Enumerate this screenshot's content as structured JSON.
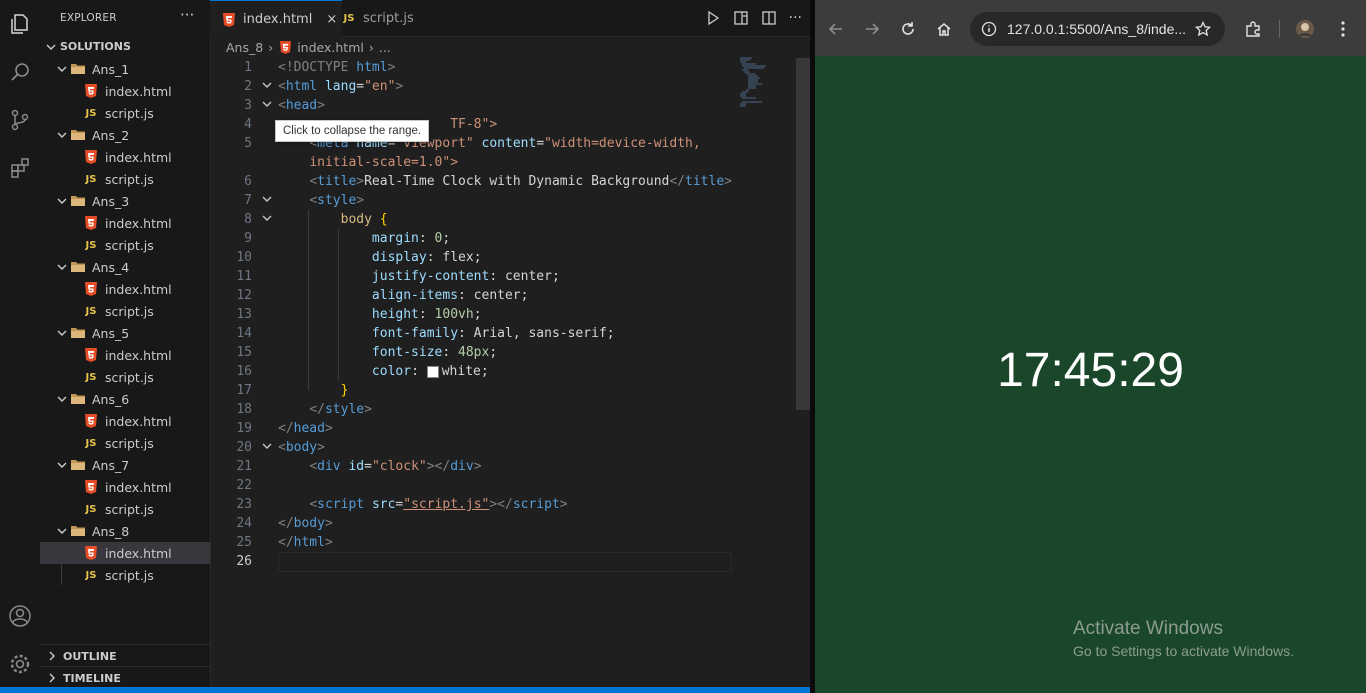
{
  "explorer": {
    "title": "EXPLORER",
    "more": "···",
    "root": "SOLUTIONS",
    "folders": [
      {
        "name": "Ans_1",
        "files": [
          "index.html",
          "script.js"
        ]
      },
      {
        "name": "Ans_2",
        "files": [
          "index.html",
          "script.js"
        ]
      },
      {
        "name": "Ans_3",
        "files": [
          "index.html",
          "script.js"
        ]
      },
      {
        "name": "Ans_4",
        "files": [
          "index.html",
          "script.js"
        ]
      },
      {
        "name": "Ans_5",
        "files": [
          "index.html",
          "script.js"
        ]
      },
      {
        "name": "Ans_6",
        "files": [
          "index.html",
          "script.js"
        ]
      },
      {
        "name": "Ans_7",
        "files": [
          "index.html",
          "script.js"
        ]
      },
      {
        "name": "Ans_8",
        "files": [
          "index.html",
          "script.js"
        ]
      }
    ],
    "selected": "Ans_8/index.html",
    "outline": "OUTLINE",
    "timeline": "TIMELINE"
  },
  "tabs": [
    {
      "label": "index.html",
      "icon": "html5-icon",
      "active": true
    },
    {
      "label": "script.js",
      "icon": "js-icon",
      "active": false
    }
  ],
  "tab_close": "×",
  "breadcrumb": {
    "folder": "Ans_8",
    "file": "index.html",
    "tail": "..."
  },
  "tooltip": "Click to collapse the range.",
  "code": {
    "line_numbers": [
      "1",
      "2",
      "3",
      "4",
      "5",
      "",
      "6",
      "7",
      "8",
      "9",
      "10",
      "11",
      "12",
      "13",
      "14",
      "15",
      "16",
      "17",
      "18",
      "19",
      "20",
      "21",
      "22",
      "23",
      "24",
      "25",
      "26"
    ],
    "l1": [
      "<!DOCTYPE ",
      "html",
      ">"
    ],
    "l2": [
      "<",
      "html ",
      "lang",
      "=",
      "\"en\"",
      ">"
    ],
    "l3": [
      "<",
      "head",
      ">"
    ],
    "l4": "TF-8\">",
    "l5": [
      "<",
      "meta ",
      "name",
      "=",
      "\"viewport\" ",
      "content",
      "=",
      "\"width=device-width,"
    ],
    "l5b": "initial-scale=1.0\">",
    "l6": [
      "<",
      "title",
      ">",
      "Real-Time Clock with Dynamic Background",
      "</",
      "title",
      ">"
    ],
    "l7": [
      "<",
      "style",
      ">"
    ],
    "l8": [
      "body ",
      "{"
    ],
    "props": [
      {
        "p": "margin",
        "v": "0",
        "t": "num"
      },
      {
        "p": "display",
        "v": "flex",
        "t": "tx"
      },
      {
        "p": "justify-content",
        "v": "center",
        "t": "tx"
      },
      {
        "p": "align-items",
        "v": "center",
        "t": "tx"
      },
      {
        "p": "height",
        "v": "100vh",
        "t": "num"
      },
      {
        "p": "font-family",
        "v": "Arial, sans-serif",
        "t": "tx"
      },
      {
        "p": "font-size",
        "v": "48px",
        "t": "num"
      },
      {
        "p": "color",
        "v": "white",
        "t": "tx",
        "swatch": "#ffffff"
      }
    ],
    "l17": "}",
    "l18": [
      "</",
      "style",
      ">"
    ],
    "l19": [
      "</",
      "head",
      ">"
    ],
    "l20": [
      "<",
      "body",
      ">"
    ],
    "l21": [
      "<",
      "div ",
      "id",
      "=",
      "\"clock\"",
      "></",
      "div",
      ">"
    ],
    "l23": [
      "<",
      "script ",
      "src",
      "=",
      "\"script.js\"",
      "></",
      "script",
      ">"
    ],
    "l24": [
      "</",
      "body",
      ">"
    ],
    "l25": [
      "</",
      "html",
      ">"
    ]
  },
  "browser": {
    "url": "127.0.0.1:5500/Ans_8/inde...",
    "clock": "17:45:29",
    "background": "#1a472a",
    "watermark_title": "Activate Windows",
    "watermark_sub": "Go to Settings to activate Windows."
  },
  "colors": {
    "accent": "#0078d4",
    "html_icon": "#e44d26",
    "js_icon": "#e8c44a"
  }
}
